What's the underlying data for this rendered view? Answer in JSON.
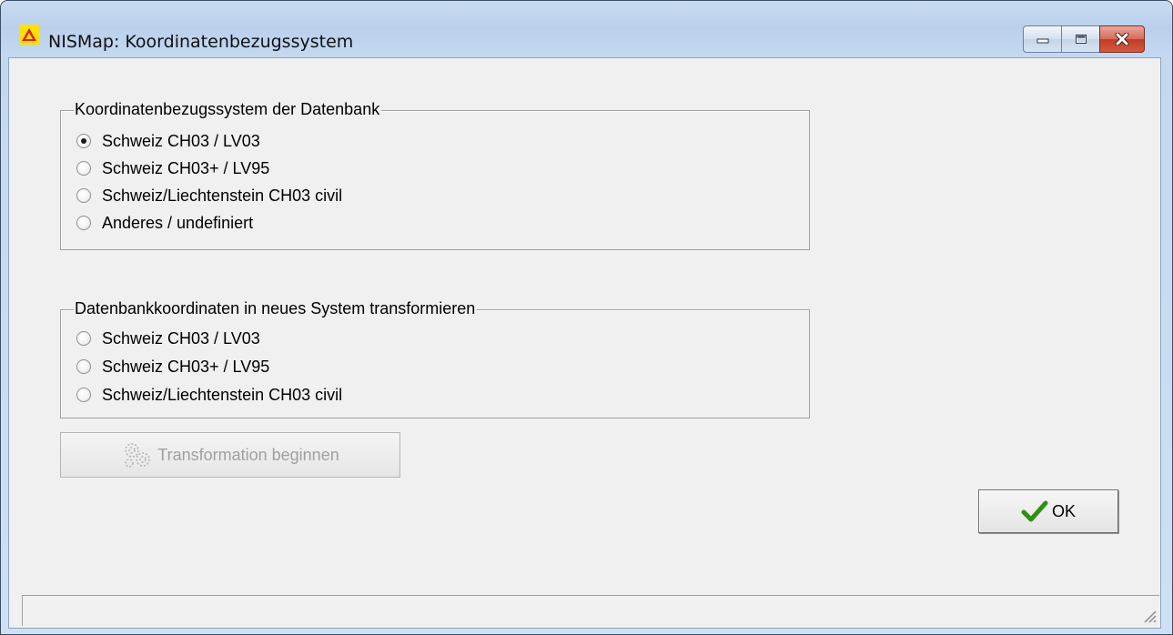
{
  "window": {
    "title": "NISMap: Koordinatenbezugssystem",
    "icon": "warning-triangle-icon",
    "controls": [
      "minimize-icon",
      "maximize-icon",
      "close-icon"
    ]
  },
  "group_source": {
    "title": "Koordinatenbezugssystem der Datenbank",
    "options": [
      {
        "label": "Schweiz CH03 / LV03",
        "checked": true
      },
      {
        "label": "Schweiz CH03+ / LV95",
        "checked": false
      },
      {
        "label": "Schweiz/Liechtenstein CH03 civil",
        "checked": false
      },
      {
        "label": "Anderes / undefiniert",
        "checked": false
      }
    ]
  },
  "group_target": {
    "title": "Datenbankkoordinaten in neues System transformieren",
    "options": [
      {
        "label": "Schweiz CH03 / LV03",
        "checked": false
      },
      {
        "label": "Schweiz CH03+ / LV95",
        "checked": false
      },
      {
        "label": "Schweiz/Liechtenstein CH03 civil",
        "checked": false
      }
    ]
  },
  "buttons": {
    "transform_label": "Transformation beginnen",
    "transform_enabled": false,
    "ok_label": "OK"
  },
  "colors": {
    "dialog_bg": "#f0f0f0",
    "close_button": "#c13c24",
    "ok_check": "#2f8f14",
    "disabled_text": "#a0a0a0"
  }
}
